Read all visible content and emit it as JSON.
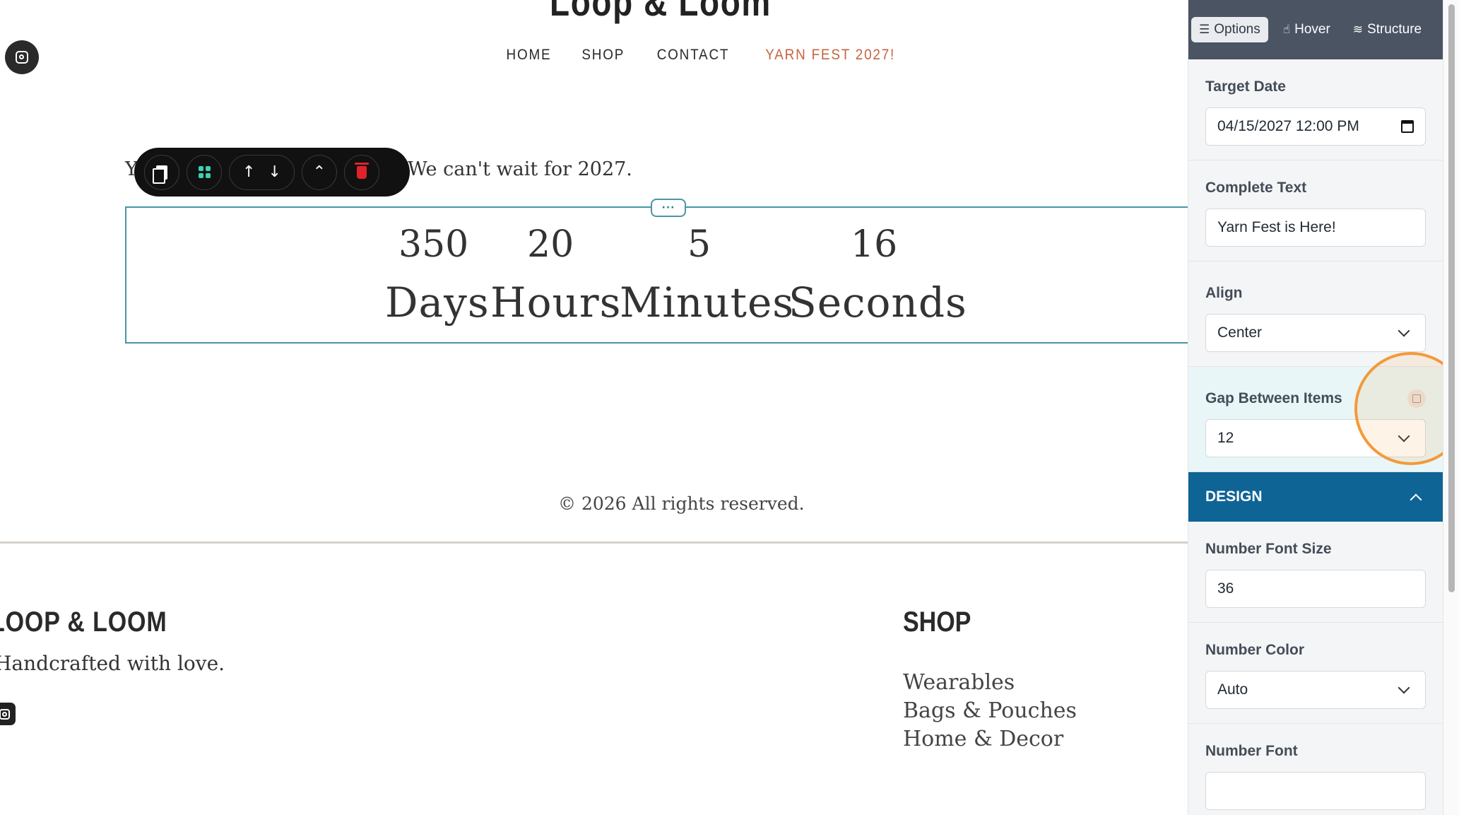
{
  "site": {
    "title": "Loop & Loom",
    "nav": [
      "HOME",
      "SHOP",
      "CONTACT",
      "YARN FEST 2027!"
    ],
    "accent_color": "#c7643f"
  },
  "section": {
    "intro_visible_start": "Y",
    "intro_visible_end": "We can't wait for 2027."
  },
  "toolbar": {
    "icons": [
      "copy-icon",
      "add-block-icon",
      "arrow-up-icon",
      "arrow-down-icon",
      "double-chevron-up-icon",
      "trash-icon"
    ],
    "up": "↑",
    "down": "↓",
    "select_parent": "⌃",
    "handle": "···"
  },
  "countdown": {
    "days": "350",
    "hours": "20",
    "minutes": "5",
    "seconds": "16",
    "days_label": "Days",
    "hours_label": "Hours",
    "minutes_label": "Minutes",
    "seconds_label": "Seconds",
    "border_color": "#4b94a6"
  },
  "footer": {
    "copyright": "© 2026 All rights reserved.",
    "brand": "LOOP & LOOM",
    "tagline": "Handcrafted with love.",
    "shop_heading": "SHOP",
    "shop_links": [
      "Wearables",
      "Bags & Pouches",
      "Home & Decor"
    ]
  },
  "panel": {
    "tabs": {
      "options": "Options",
      "hover": "Hover",
      "structure": "Structure"
    },
    "target_date_label": "Target Date",
    "target_date_value": "04/15/2027 12:00 PM",
    "complete_text_label": "Complete Text",
    "complete_text_value": "Yarn Fest is Here!",
    "align_label": "Align",
    "align_value": "Center",
    "gap_label": "Gap Between Items",
    "gap_value": "12",
    "design_section": "DESIGN",
    "number_font_size_label": "Number Font Size",
    "number_font_size_value": "36",
    "number_color_label": "Number Color",
    "number_color_value": "Auto",
    "number_font_label": "Number Font",
    "header_color": "#4a5463",
    "design_color": "#0f6496",
    "highlight_color": "#f39a3a"
  }
}
